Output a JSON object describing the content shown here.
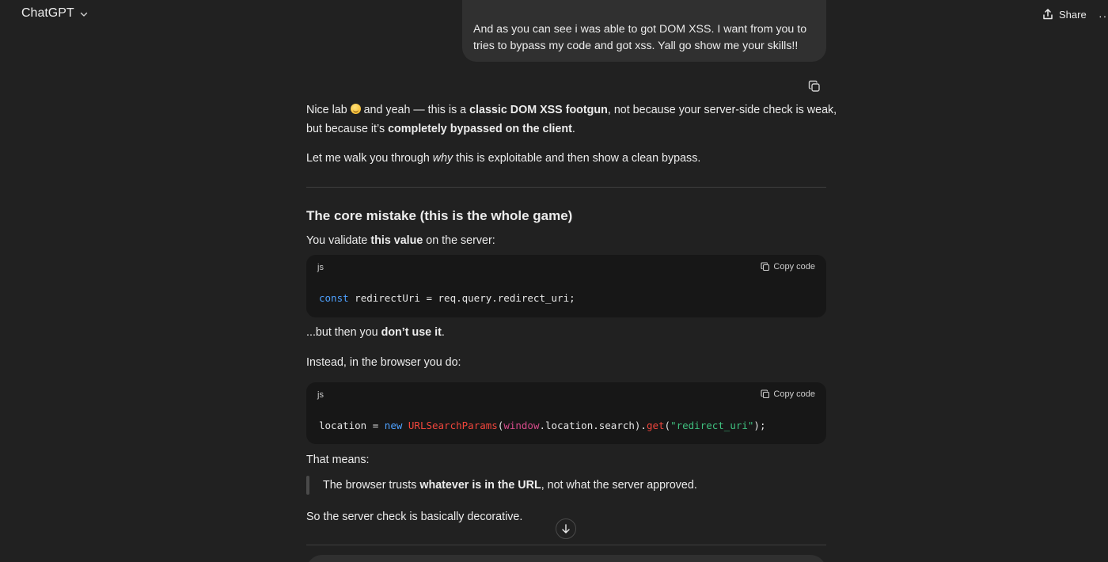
{
  "header": {
    "model_name": "ChatGPT",
    "share_label": "Share",
    "more_label": "··"
  },
  "user_message": {
    "text": "And as you can see i was able to got DOM XSS. I want from you to tries to bypass my code and got xss. Yall go show me your skills!!"
  },
  "assistant": {
    "intro_1": {
      "a": "Nice lab ",
      "b": " and yeah — this is a ",
      "c": "classic DOM XSS footgun",
      "d": ", not because your server-side check is weak,"
    },
    "intro_2": {
      "a": "but because it’s ",
      "b": "completely bypassed on the client",
      "c": "."
    },
    "walk": {
      "a": "Let me walk you through ",
      "b": "why",
      "c": " this is exploitable and then show a clean bypass."
    },
    "heading": "The core mistake (this is the whole game)",
    "validate": {
      "a": "You validate ",
      "b": "this value",
      "c": " on the server:"
    },
    "code_1": {
      "lang": "js",
      "copy_label": "Copy code",
      "kw": "const",
      "rest": " redirectUri = req.query.redirect_uri;"
    },
    "dont_use": {
      "a": "...but then you ",
      "b": "don’t use it",
      "c": "."
    },
    "instead": "Instead, in the browser you do:",
    "code_2": {
      "lang": "js",
      "copy_label": "Copy code",
      "t1": "location = ",
      "kw": "new",
      "t2": " ",
      "ty": "URLSearchParams",
      "t3": "(",
      "gl": "window",
      "t4": ".location.search).",
      "fn": "get",
      "t5": "(",
      "str": "\"redirect_uri\"",
      "t6": ");"
    },
    "that_means": "That means:",
    "quote": {
      "a": "The browser trusts ",
      "b": "whatever is in the URL",
      "c": ", not what the server approved."
    },
    "decorative": "So the server check is basically decorative."
  },
  "icons": {
    "model_chevron": "chevron-down-icon",
    "share": "share-icon",
    "copy": "copy-icon",
    "scroll": "arrow-down-icon"
  },
  "colors": {
    "background": "#212121",
    "user_bubble": "#303030",
    "code_bg": "#171717",
    "keyword": "#4ea1ff",
    "type": "#f0463c",
    "string": "#3fbf7f"
  }
}
